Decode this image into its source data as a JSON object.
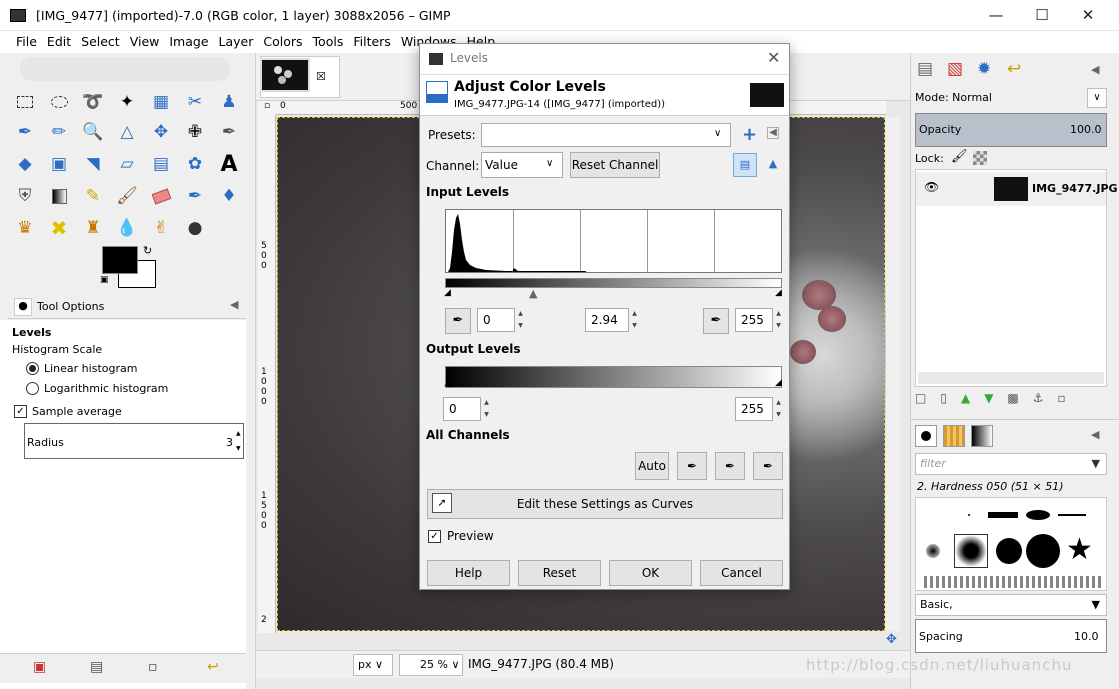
{
  "window": {
    "title": "[IMG_9477] (imported)-7.0 (RGB color, 1 layer) 3088x2056 – GIMP"
  },
  "menu": [
    "File",
    "Edit",
    "Select",
    "View",
    "Image",
    "Layer",
    "Colors",
    "Tools",
    "Filters",
    "Windows",
    "Help"
  ],
  "tool_options": {
    "tab_label": "Tool Options",
    "tool_name": "Levels",
    "histogram_scale_label": "Histogram Scale",
    "linear": "Linear histogram",
    "logarithmic": "Logarithmic histogram",
    "sample_average": "Sample average",
    "radius_label": "Radius",
    "radius_value": "3"
  },
  "image_window": {
    "zoom": "25 %",
    "unit": "px",
    "status": "IMG_9477.JPG (80.4 MB)",
    "ruler_top": [
      "0",
      "500"
    ],
    "ruler_left": [
      "5",
      "0",
      "0",
      "1",
      "0",
      "0",
      "0",
      "1",
      "5",
      "0",
      "0",
      "2"
    ]
  },
  "dock": {
    "mode_label": "Mode: Normal",
    "opacity_label": "Opacity",
    "opacity_value": "100.0",
    "lock_label": "Lock:",
    "layer_name": "IMG_9477.JPG",
    "filter_placeholder": "filter",
    "brush_name": "2. Hardness 050 (51 × 51)",
    "preset": "Basic,",
    "spacing_label": "Spacing",
    "spacing_value": "10.0"
  },
  "levels_dialog": {
    "window_title": "Levels",
    "heading": "Adjust Color Levels",
    "subtitle": "IMG_9477.JPG-14 ([IMG_9477] (imported))",
    "presets_label": "Presets:",
    "presets_value": "",
    "channel_label": "Channel:",
    "channel_value": "Value",
    "reset_channel": "Reset Channel",
    "input_levels": "Input Levels",
    "input_low": "0",
    "input_gamma": "2.94",
    "input_high": "255",
    "output_levels": "Output Levels",
    "output_low": "0",
    "output_high": "255",
    "all_channels": "All Channels",
    "auto": "Auto",
    "edit_as_curves": "Edit these Settings as Curves",
    "preview": "Preview",
    "buttons": {
      "help": "Help",
      "reset": "Reset",
      "ok": "OK",
      "cancel": "Cancel"
    }
  },
  "watermark": "http://blog.csdn.net/liuhuanchu"
}
